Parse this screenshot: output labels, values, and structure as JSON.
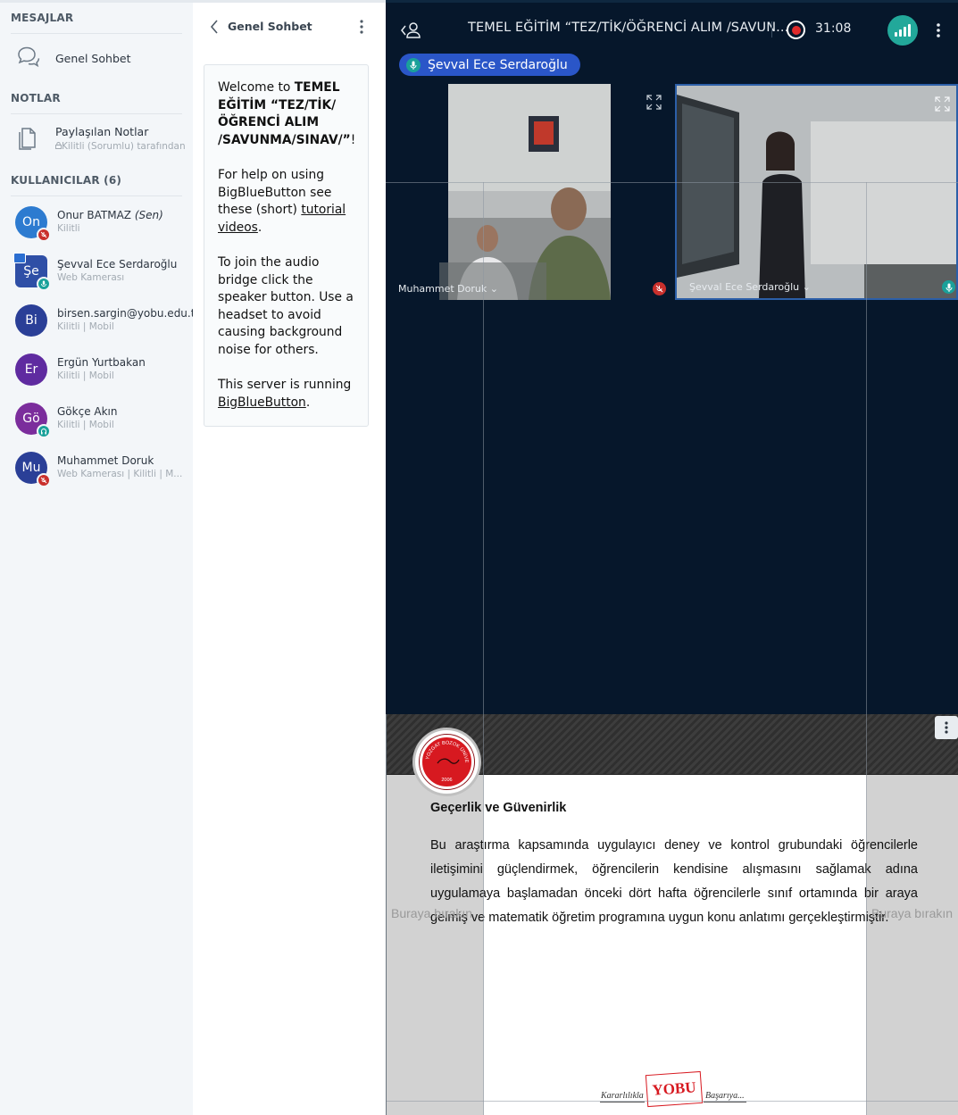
{
  "sidebar": {
    "messages_title": "MESAJLAR",
    "public_chat_label": "Genel Sohbet",
    "notes_title": "NOTLAR",
    "shared_notes_label": "Paylaşılan Notlar",
    "shared_notes_sub": "Kilitli (Sorumlu) tarafından",
    "users_title": "KULLANICILAR (6)",
    "users": [
      {
        "initials": "On",
        "name": "Onur BATMAZ",
        "suffix": "(Sen)",
        "meta": "Kilitli",
        "color": "#2d7bd0",
        "badge": "mic-off"
      },
      {
        "initials": "Şe",
        "name": "Şevval Ece Serdaroğlu",
        "suffix": "",
        "meta": "Web Kamerası",
        "color": "#2f4fa6",
        "badge": "mic-on"
      },
      {
        "initials": "Bi",
        "name": "birsen.sargin@yobu.edu.tr",
        "suffix": "",
        "meta": "Kilitli | Mobil",
        "color": "#2a3f97",
        "badge": ""
      },
      {
        "initials": "Er",
        "name": "Ergün Yurtbakan",
        "suffix": "",
        "meta": "Kilitli | Mobil",
        "color": "#5f2ba0",
        "badge": ""
      },
      {
        "initials": "Gö",
        "name": "Gökçe Akın",
        "suffix": "",
        "meta": "Kilitli | Mobil",
        "color": "#7b2d9c",
        "badge": "listen"
      },
      {
        "initials": "Mu",
        "name": "Muhammet Doruk",
        "suffix": "",
        "meta": "Web Kamerası | Kilitli | M...",
        "color": "#2a3f97",
        "badge": "mic-off"
      }
    ]
  },
  "chat": {
    "title": "Genel Sohbet",
    "welcome_prefix": "Welcome to ",
    "welcome_name": "TEMEL EĞİTİM “TEZ/TİK/ ÖĞRENCİ ALIM /SAVUNMA/SINAV/”",
    "welcome_suffix": "!",
    "help_text": "For help on using BigBlueButton see these (short) ",
    "help_link": "tutorial videos",
    "help_end": ".",
    "audio_text": "To join the audio bridge click the speaker button. Use a headset to avoid causing background noise for others.",
    "server_text": "This server is running ",
    "server_link": "BigBlueButton",
    "server_end": "."
  },
  "topbar": {
    "meeting_title": "TEMEL EĞİTİM “TEZ/TİK/ÖĞRENCİ ALIM /SAVUN...",
    "recording_time": "31:08",
    "talking_user": "Şevval Ece Serdaroğlu"
  },
  "videos": [
    {
      "name": "Muhammet Doruk"
    },
    {
      "name": "Şevval Ece Serdaroğlu"
    }
  ],
  "slide": {
    "title": "Geçerlik ve Güvenirlik",
    "body": "Bu araştırma kapsamında uygulayıcı deney ve kontrol grubundaki öğrencilerle iletişimini güçlendirmek, öğrencilerin kendisine alışmasını sağlamak adına uygulamaya başlamadan önceki dört hafta öğrencilerle sınıf ortamında bir araya gelmiş ve matematik öğretim programına uygun konu anlatımı gerçekleştirmiştir.",
    "logo_top_text": "YOZGAT BOZOK ÜNİVERSİTESİ",
    "logo_year": "2006",
    "footer_logo": "YOBU",
    "footer_left": "Kararlılıkla",
    "footer_right": "Başarıya..."
  },
  "drop_hints": {
    "left": "Buraya bırakın",
    "right": "Buraya bırakın"
  },
  "colors": {
    "accent": "#2a56c8",
    "main_bg": "#06172b",
    "connection": "#22a89a",
    "recording": "#e02a2a"
  }
}
